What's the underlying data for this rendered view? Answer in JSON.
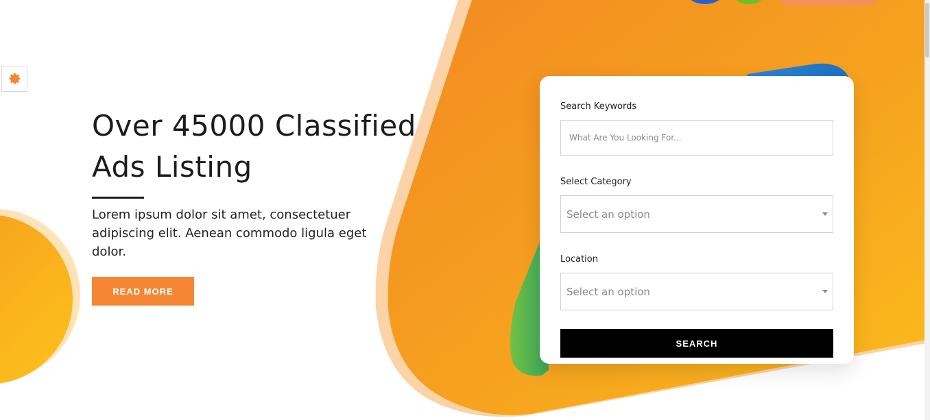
{
  "colors": {
    "accent_orange": "#f58634",
    "orange_light": "#f7a823",
    "orange_pale": "#fbd3a6",
    "yellow": "#fdbc1c",
    "blue": "#2a73d6",
    "green": "#74c043",
    "black": "#000000"
  },
  "settings": {
    "icon": "gear-icon"
  },
  "hero": {
    "title_line1": "Over 45000 Classified",
    "title_line2": "Ads Listing",
    "description": "Lorem ipsum dolor sit amet, consectetuer adipiscing elit. Aenean commodo ligula eget dolor.",
    "read_more_label": "READ MORE"
  },
  "search_form": {
    "keywords_label": "Search Keywords",
    "keywords_placeholder": "What Are You Looking For...",
    "keywords_value": "",
    "category_label": "Select Category",
    "category_value": "Select an option",
    "location_label": "Location",
    "location_value": "Select an option",
    "search_label": "SEARCH"
  }
}
